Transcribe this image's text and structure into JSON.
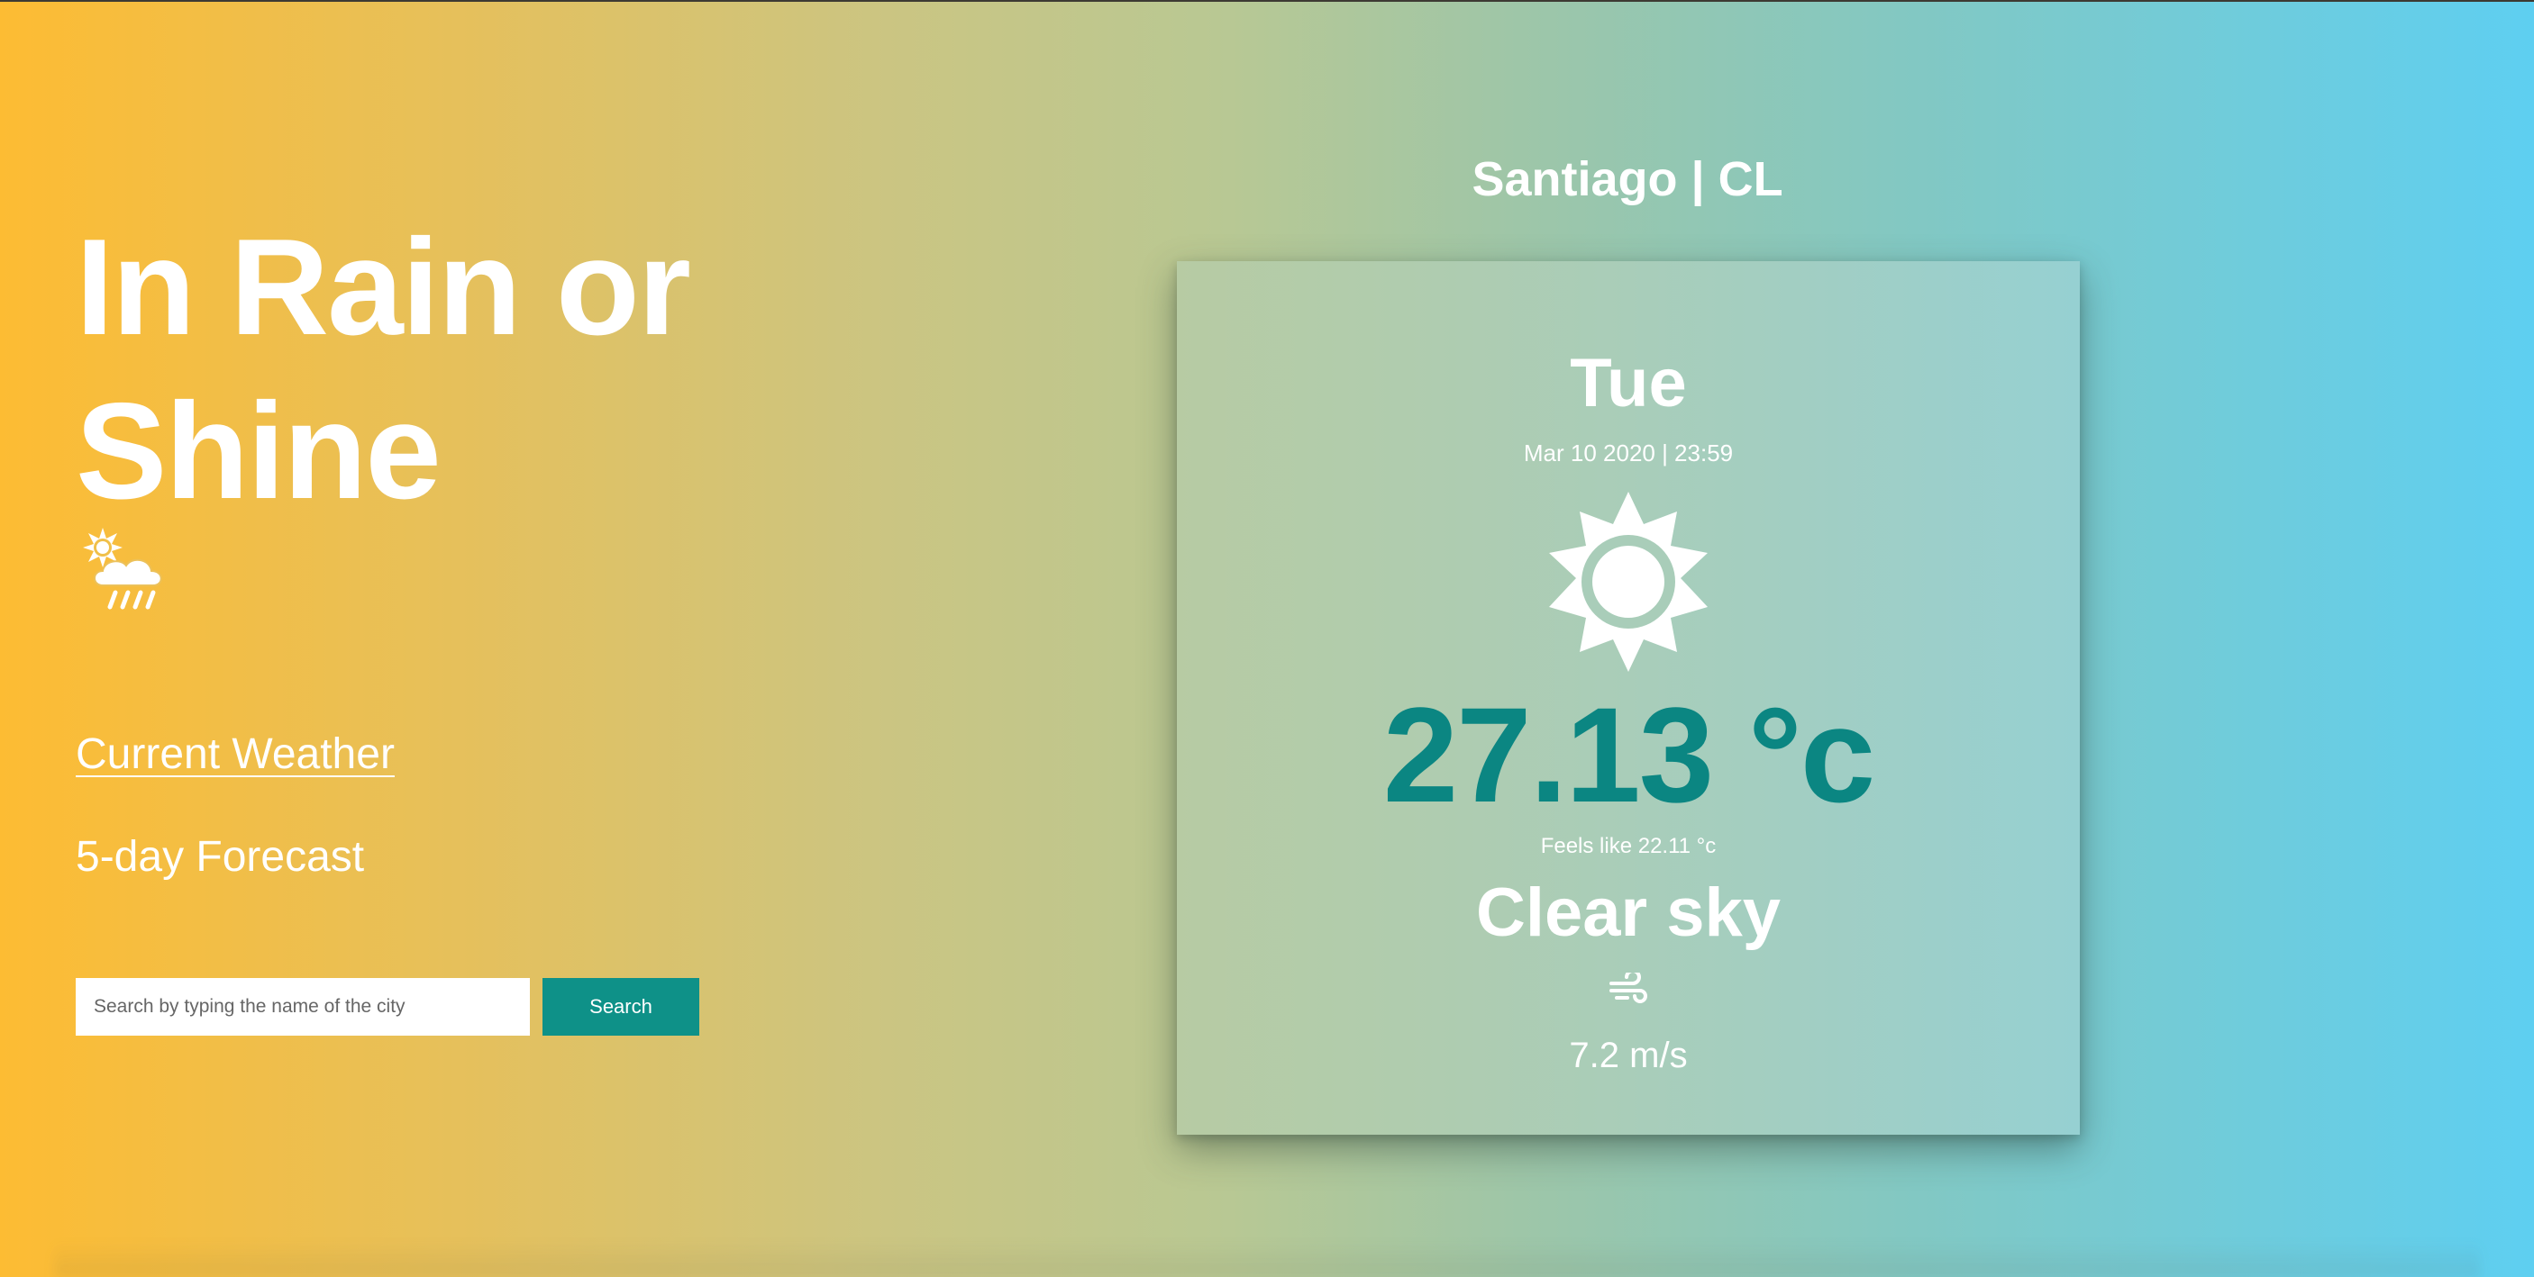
{
  "hero": {
    "title": "In Rain or Shine",
    "icon": "sun-cloud-rain-icon"
  },
  "nav": {
    "current_weather": "Current Weather",
    "forecast": "5-day Forecast"
  },
  "search": {
    "placeholder": "Search by typing the name of the city",
    "value": "",
    "button_label": "Search"
  },
  "location": {
    "title": "Santiago | CL"
  },
  "weather": {
    "day": "Tue",
    "datetime": "Mar 10 2020 | 23:59",
    "icon": "sun-icon",
    "temperature": "27.13 °c",
    "feels_like": "Feels like 22.11 °c",
    "description": "Clear sky",
    "wind_icon": "wind-icon",
    "wind_speed": "7.2 m/s"
  },
  "colors": {
    "gradient_start": "#fdbc33",
    "gradient_end": "#5ecff1",
    "accent": "#0e9188",
    "temperature_text": "#0b8682",
    "text": "#ffffff"
  }
}
